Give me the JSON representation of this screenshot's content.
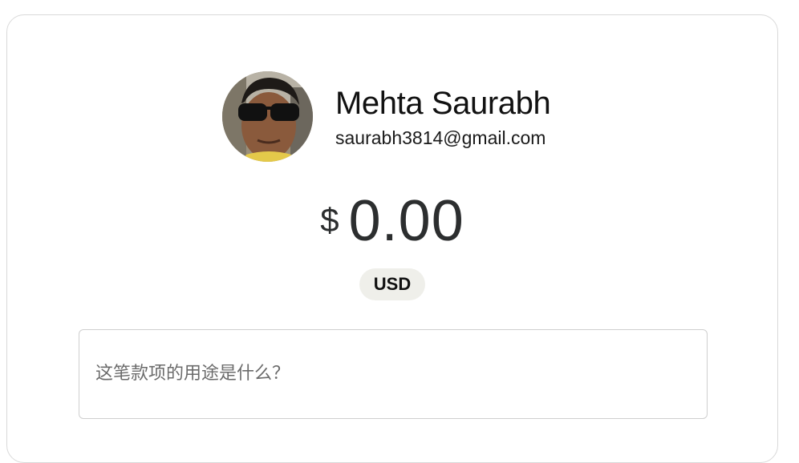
{
  "profile": {
    "name": "Mehta Saurabh",
    "email": "saurabh3814@gmail.com",
    "avatar_icon": "user-photo"
  },
  "amount": {
    "currency_symbol": "$",
    "value": "0.00"
  },
  "currency": {
    "code": "USD"
  },
  "note": {
    "placeholder": "这笔款项的用途是什么？"
  },
  "colors": {
    "amount_text": "#2c2e2f",
    "badge_background": "#efefea",
    "border": "#cfcfcf"
  }
}
